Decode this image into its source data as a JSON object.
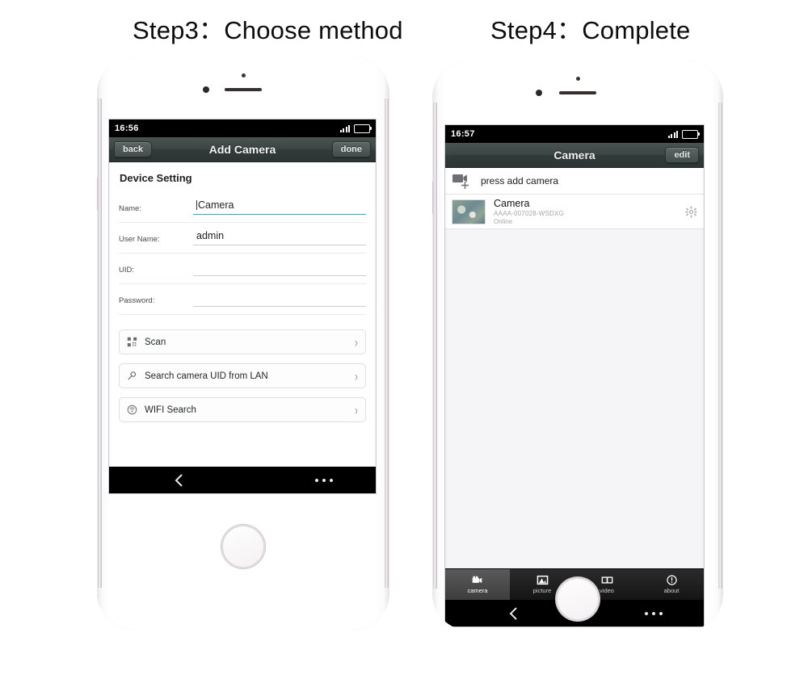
{
  "headings": {
    "step3": "Step3：Choose method",
    "step4": "Step4：Complete"
  },
  "phone1": {
    "status": {
      "time": "16:56",
      "signal_icon": "signal-bars-icon",
      "battery_icon": "battery-icon"
    },
    "navbar": {
      "back_label": "back",
      "title": "Add Camera",
      "done_label": "done"
    },
    "form": {
      "section_title": "Device Setting",
      "fields": [
        {
          "label": "Name:",
          "value": "Camera",
          "focused": true
        },
        {
          "label": "User Name:",
          "value": "admin",
          "focused": false
        },
        {
          "label": "UID:",
          "value": "",
          "focused": false
        },
        {
          "label": "Password:",
          "value": "",
          "focused": false
        }
      ]
    },
    "actions": [
      {
        "icon": "qr-scan-icon",
        "label": "Scan",
        "chevron": "›"
      },
      {
        "icon": "magnifier-icon",
        "label": "Search camera UID from LAN",
        "chevron": "›"
      },
      {
        "icon": "wifi-icon",
        "label": "WIFI Search",
        "chevron": "›"
      }
    ],
    "softkeys": {
      "back_icon": "chevron-left-icon",
      "menu_icon": "more-dots-icon"
    }
  },
  "phone2": {
    "status": {
      "time": "16:57",
      "signal_icon": "signal-bars-icon",
      "battery_icon": "battery-icon"
    },
    "navbar": {
      "title": "Camera",
      "edit_label": "edit"
    },
    "add_row": {
      "icon": "video-camera-plus-icon",
      "label": "press add camera"
    },
    "camera": {
      "thumbnail": "camera-snapshot-thumb",
      "name": "Camera",
      "uid": "AAAA-007028-WSDXG",
      "status": "Online",
      "settings_icon": "gear-icon"
    },
    "tabs": [
      {
        "icon": "camera-icon",
        "label": "camera",
        "active": true
      },
      {
        "icon": "picture-icon",
        "label": "picture",
        "active": false
      },
      {
        "icon": "video-icon",
        "label": "video",
        "active": false
      },
      {
        "icon": "about-icon",
        "label": "about",
        "active": false
      }
    ],
    "softkeys": {
      "back_icon": "chevron-left-icon",
      "menu_icon": "more-dots-icon"
    }
  },
  "colors": {
    "navbar": "#3b4544",
    "focus_underline": "#27b0c4",
    "list_bg": "#f5f5f7",
    "muted_text": "#a6a6aa"
  }
}
